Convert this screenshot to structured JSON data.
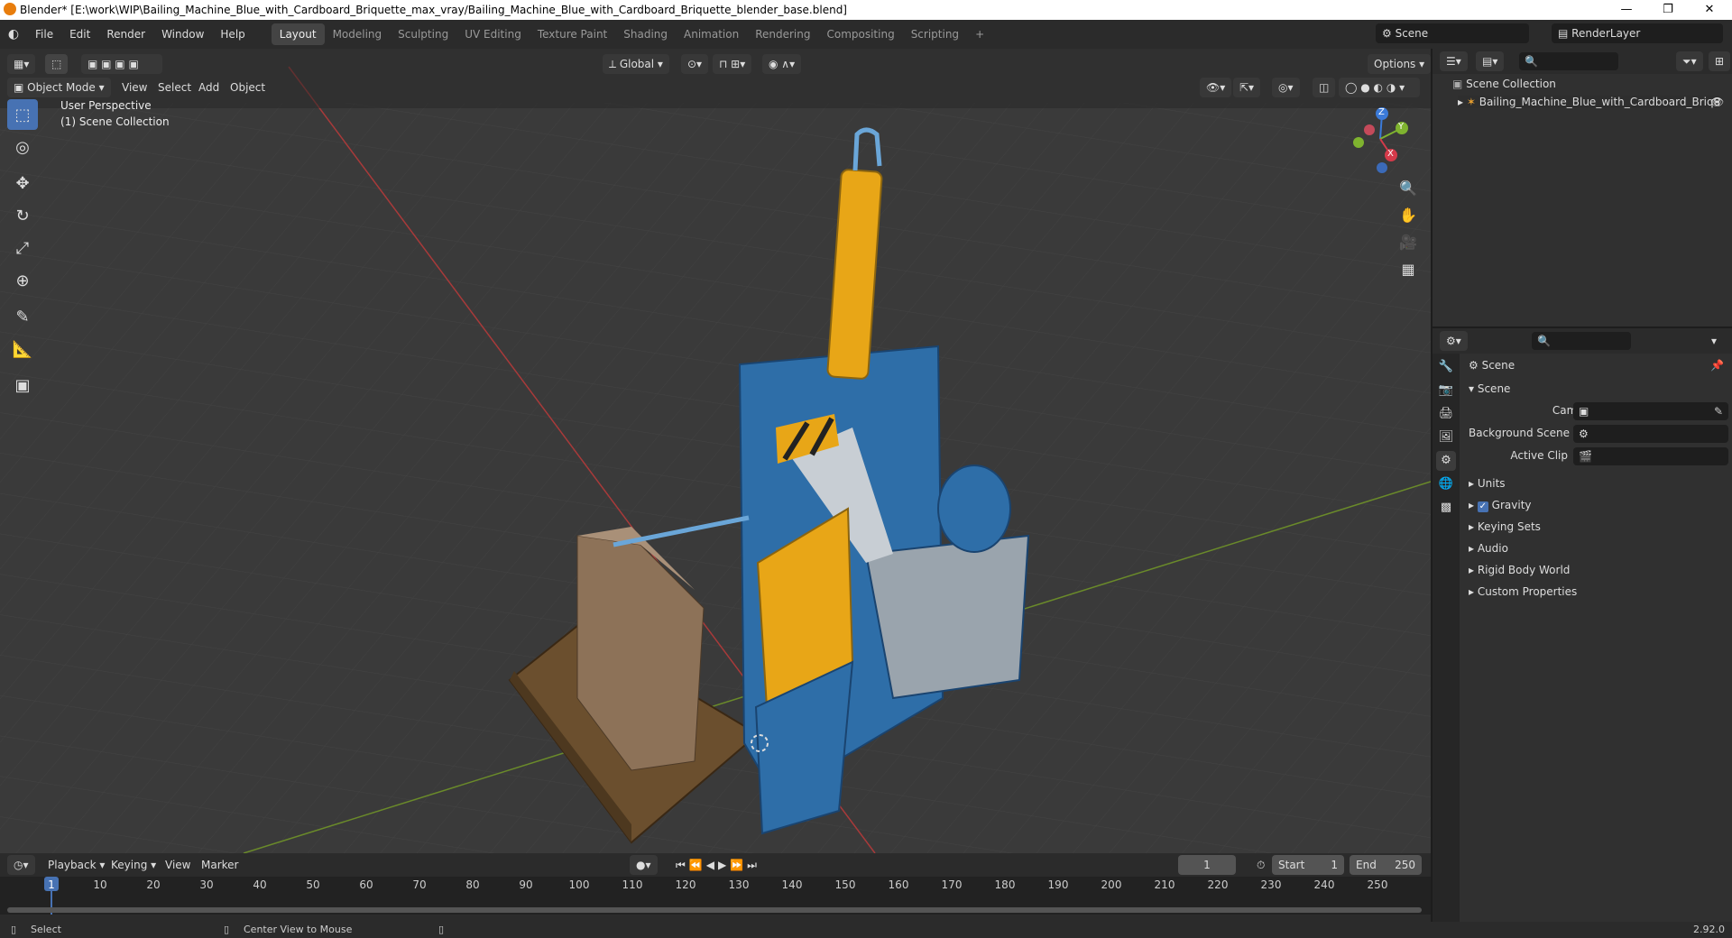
{
  "window": {
    "title": "Blender* [E:\\work\\WIP\\Bailing_Machine_Blue_with_Cardboard_Briquette_max_vray/Bailing_Machine_Blue_with_Cardboard_Briquette_blender_base.blend]",
    "minimize": "—",
    "maximize": "❐",
    "close": "✕"
  },
  "menus": [
    "File",
    "Edit",
    "Render",
    "Window",
    "Help"
  ],
  "workspaces": [
    "Layout",
    "Modeling",
    "Sculpting",
    "UV Editing",
    "Texture Paint",
    "Shading",
    "Animation",
    "Rendering",
    "Compositing",
    "Scripting"
  ],
  "active_workspace": "Layout",
  "scene_name": "Scene",
  "render_layer": "RenderLayer",
  "viewport": {
    "mode": "Object Mode",
    "menus": [
      "View",
      "Select",
      "Add",
      "Object"
    ],
    "orientation": "Global",
    "options": "Options",
    "perspective": "User Perspective",
    "collection": "(1) Scene Collection"
  },
  "gizmo": {
    "x": "X",
    "y": "Y",
    "z": "Z"
  },
  "outliner": {
    "root": "Scene Collection",
    "item": "Bailing_Machine_Blue_with_Cardboard_Briquette"
  },
  "properties": {
    "context": "Scene",
    "section": "Scene",
    "camera_label": "Camera",
    "background_label": "Background Scene",
    "clip_label": "Active Clip",
    "panels": [
      "Units",
      "Gravity",
      "Keying Sets",
      "Audio",
      "Rigid Body World",
      "Custom Properties"
    ]
  },
  "timeline": {
    "menus": [
      "Playback",
      "Keying",
      "View",
      "Marker"
    ],
    "current_frame": "1",
    "start_label": "Start",
    "start": "1",
    "end_label": "End",
    "end": "250",
    "ticks": [
      "1",
      "10",
      "20",
      "30",
      "40",
      "50",
      "60",
      "70",
      "80",
      "90",
      "100",
      "110",
      "120",
      "130",
      "140",
      "150",
      "160",
      "170",
      "180",
      "190",
      "200",
      "210",
      "220",
      "230",
      "240",
      "250"
    ]
  },
  "status": {
    "left": "Select",
    "middle": "Center View to Mouse",
    "version": "2.92.0"
  },
  "colors": {
    "accent": "#4772b3",
    "machine_blue": "#2e6ea8",
    "cylinder_yellow": "#e8a617"
  }
}
